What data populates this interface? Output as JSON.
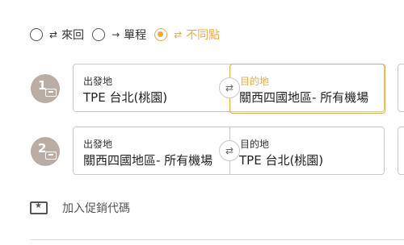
{
  "trip_types": [
    {
      "label": "來回",
      "icon": "round-trip-arrows-icon",
      "checked": false
    },
    {
      "label": "單程",
      "icon": "right-arrow-icon",
      "checked": false
    },
    {
      "label": "不同點",
      "icon": "multi-city-arrows-icon",
      "checked": true
    }
  ],
  "segments": [
    {
      "step": "1",
      "from_label": "出發地",
      "from_value": "TPE 台北(桃園)",
      "to_label": "目的地",
      "to_value": "關西四國地區- 所有機場",
      "active_field": "to"
    },
    {
      "step": "2",
      "from_label": "出發地",
      "from_value": "關西四國地區- 所有機場",
      "to_label": "目的地",
      "to_value": "TPE 台北(桃園)",
      "active_field": ""
    }
  ],
  "promo": {
    "label": "加入促銷代碼"
  },
  "colors": {
    "accent": "#f0a93b",
    "step_badge": "#b9ada5",
    "border": "#c9c9c9"
  }
}
